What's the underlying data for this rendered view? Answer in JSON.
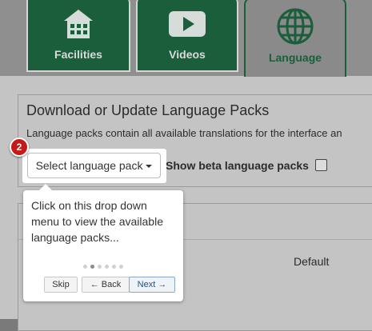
{
  "tabs": [
    {
      "label": "Facilities",
      "icon": "building-icon",
      "active": false
    },
    {
      "label": "Videos",
      "icon": "play-icon",
      "active": false
    },
    {
      "label": "Language",
      "icon": "globe-icon",
      "active": true
    }
  ],
  "section": {
    "title": "Download or Update Language Packs",
    "description": "Language packs contain all available translations for the interface an",
    "select_label": "Select language pack",
    "beta_label": "Show beta language packs"
  },
  "table": {
    "default_label": "Default"
  },
  "tour": {
    "step_number": "2",
    "text": "Click on this drop down menu to view the available language packs...",
    "total_steps": 6,
    "current_step": 2,
    "skip_label": "Skip",
    "back_label": "← Back",
    "next_label": "Next →"
  },
  "colors": {
    "tab_green": "#1b5e3b",
    "badge_red": "#c41a1a"
  }
}
